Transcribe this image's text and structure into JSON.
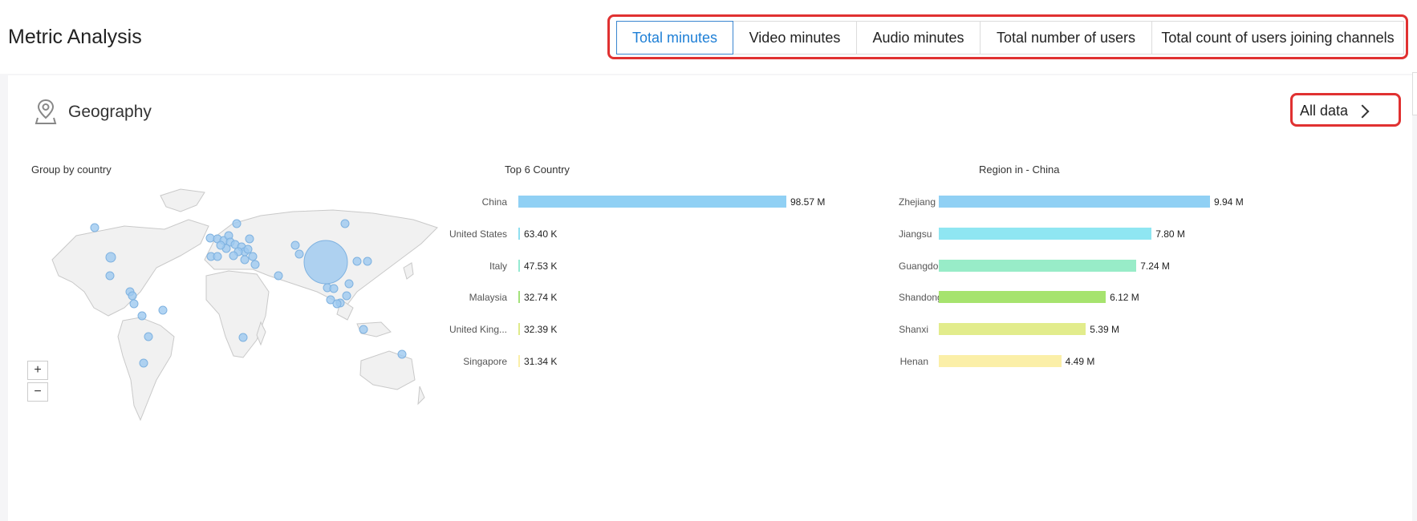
{
  "header": {
    "title": "Metric Analysis",
    "tabs": [
      {
        "label": "Total minutes",
        "active": true
      },
      {
        "label": "Video minutes",
        "active": false
      },
      {
        "label": "Audio minutes",
        "active": false
      },
      {
        "label": "Total number of users",
        "active": false
      },
      {
        "label": "Total count of users joining channels",
        "active": false
      }
    ]
  },
  "geography": {
    "title": "Geography",
    "icon": "map-pin-icon",
    "all_data_label": "All data",
    "map": {
      "title": "Group by country",
      "zoom_in": "+",
      "zoom_out": "−",
      "bubble_color": "#9ec9f0"
    },
    "top_countries": {
      "title": "Top 6 Country",
      "colors": [
        "#90d0f4",
        "#8fdff0",
        "#95ead2",
        "#a3e27a",
        "#dfeb8a",
        "#fbefa8"
      ],
      "rows": [
        {
          "label": "China",
          "value": 98.57,
          "unit": "M",
          "display": "98.57 M"
        },
        {
          "label": "United States",
          "value": 63.4,
          "unit": "K",
          "display": "63.40 K"
        },
        {
          "label": "Italy",
          "value": 47.53,
          "unit": "K",
          "display": "47.53 K"
        },
        {
          "label": "Malaysia",
          "value": 32.74,
          "unit": "K",
          "display": "32.74 K"
        },
        {
          "label": "United King...",
          "value": 32.39,
          "unit": "K",
          "display": "32.39 K"
        },
        {
          "label": "Singapore",
          "value": 31.34,
          "unit": "K",
          "display": "31.34 K"
        }
      ]
    },
    "regions": {
      "title": "Region in - China",
      "colors": [
        "#90d0f4",
        "#8fe6f2",
        "#98ecc8",
        "#a6e36e",
        "#e2ec8c",
        "#fbefa8"
      ],
      "rows": [
        {
          "label": "Zhejiang",
          "value": 9.94,
          "display": "9.94 M"
        },
        {
          "label": "Jiangsu",
          "value": 7.8,
          "display": "7.80 M"
        },
        {
          "label": "Guangdong",
          "value": 7.24,
          "display": "7.24 M"
        },
        {
          "label": "Shandong",
          "value": 6.12,
          "display": "6.12 M"
        },
        {
          "label": "Shanxi",
          "value": 5.39,
          "display": "5.39 M"
        },
        {
          "label": "Henan",
          "value": 4.49,
          "display": "4.49 M"
        }
      ]
    }
  }
}
